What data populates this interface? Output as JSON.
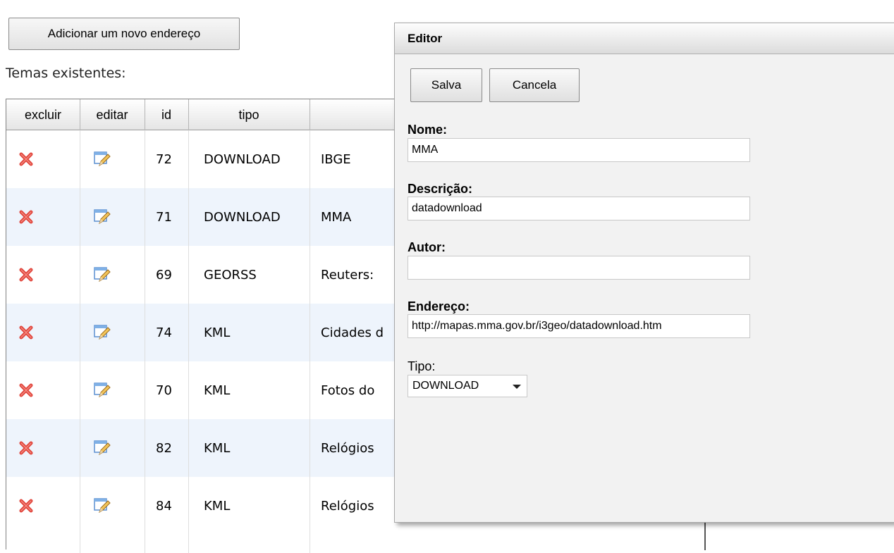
{
  "add_button_label": "Adicionar um novo endereço",
  "temas_label": "Temas existentes:",
  "table": {
    "headers": [
      "excluir",
      "editar",
      "id",
      "tipo"
    ],
    "rows": [
      {
        "id": "72",
        "tipo": "DOWNLOAD",
        "nome": "IBGE"
      },
      {
        "id": "71",
        "tipo": "DOWNLOAD",
        "nome": "MMA"
      },
      {
        "id": "69",
        "tipo": "GEORSS",
        "nome": "Reuters:"
      },
      {
        "id": "74",
        "tipo": "KML",
        "nome": "Cidades d"
      },
      {
        "id": "70",
        "tipo": "KML",
        "nome": "Fotos do"
      },
      {
        "id": "82",
        "tipo": "KML",
        "nome": "Relógios"
      },
      {
        "id": "84",
        "tipo": "KML",
        "nome": "Relógios"
      }
    ],
    "delete_icon": "delete-x-icon",
    "edit_icon": "edit-pencil-icon"
  },
  "editor": {
    "title": "Editor",
    "save_label": "Salva",
    "cancel_label": "Cancela",
    "nome_label": "Nome:",
    "nome_value": "MMA",
    "descricao_label": "Descrição:",
    "descricao_value": "datadownload",
    "autor_label": "Autor:",
    "autor_value": "",
    "endereco_label": "Endereço:",
    "endereco_value": "http://mapas.mma.gov.br/i3geo/datadownload.htm",
    "tipo_label": "Tipo:",
    "tipo_value": "DOWNLOAD"
  },
  "colors": {
    "alt_row": "#eef4fc",
    "delete_red": "#e0433a",
    "dialog_bg": "#f2f2f2"
  }
}
